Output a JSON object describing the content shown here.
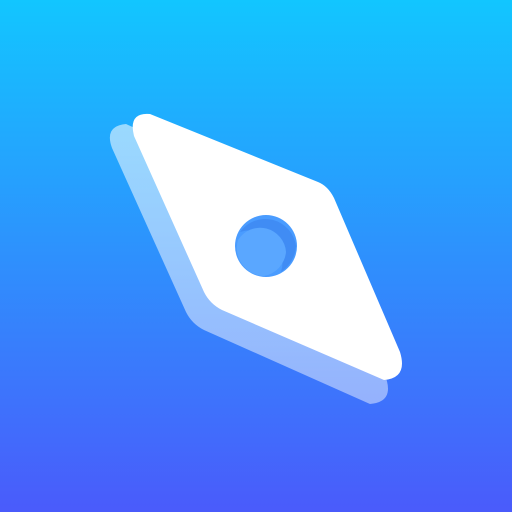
{
  "icon": {
    "name": "compass-needle-icon",
    "colors": {
      "background_top": "#12C6FF",
      "background_bottom": "#4A5BFB",
      "needle_front": "#FFFFFF",
      "needle_shadow": "#B9D3FF",
      "hole_fill": "#4A9CFF",
      "hole_shade": "#3A7CE6"
    }
  }
}
